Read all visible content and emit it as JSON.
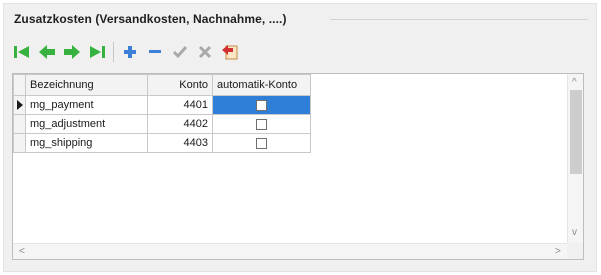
{
  "groupbox": {
    "title": "Zusatzkosten (Versandkosten, Nachnahme, ....)"
  },
  "toolbar": {
    "buttons": [
      {
        "name": "first-record",
        "icon": "first-icon",
        "color": "#37b23e"
      },
      {
        "name": "prior-record",
        "icon": "prior-icon",
        "color": "#37b23e"
      },
      {
        "name": "next-record",
        "icon": "next-icon",
        "color": "#37b23e"
      },
      {
        "name": "last-record",
        "icon": "last-icon",
        "color": "#37b23e"
      },
      {
        "name": "insert-record",
        "icon": "plus-icon",
        "color": "#3b7fd6"
      },
      {
        "name": "delete-record",
        "icon": "minus-icon",
        "color": "#3b7fd6"
      },
      {
        "name": "post-edit",
        "icon": "check-icon",
        "color": "#a9a9a9"
      },
      {
        "name": "cancel-edit",
        "icon": "x-icon",
        "color": "#a9a9a9"
      },
      {
        "name": "refresh",
        "icon": "refresh-icon",
        "color": "#d03030"
      }
    ]
  },
  "grid": {
    "columns": [
      "Bezeichnung",
      "Konto",
      "automatik-Konto"
    ],
    "rows": [
      {
        "name": "mg_payment",
        "konto": "4401",
        "auto": false,
        "current": true
      },
      {
        "name": "mg_adjustment",
        "konto": "4402",
        "auto": false,
        "current": false
      },
      {
        "name": "mg_shipping",
        "konto": "4403",
        "auto": false,
        "current": false
      }
    ]
  },
  "scrollbars": {
    "up": "^",
    "down": "v",
    "left": "<",
    "right": ">"
  }
}
